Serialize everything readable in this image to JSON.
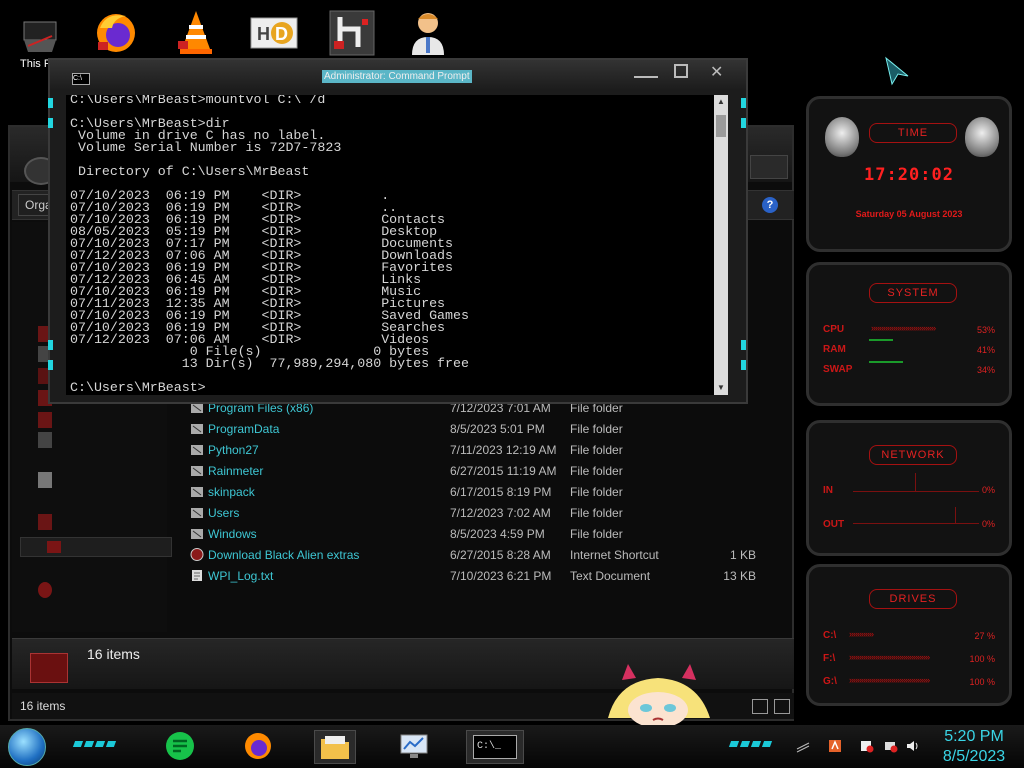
{
  "desktop": {
    "this_pc_label": "This PC"
  },
  "explorer": {
    "organize_label": "Orga",
    "help_label": "?",
    "files": [
      {
        "name": "Program Files (x86)",
        "date": "7/12/2023 7:01 AM",
        "type": "File folder",
        "size": ""
      },
      {
        "name": "ProgramData",
        "date": "8/5/2023 5:01 PM",
        "type": "File folder",
        "size": ""
      },
      {
        "name": "Python27",
        "date": "7/11/2023 12:19 AM",
        "type": "File folder",
        "size": ""
      },
      {
        "name": "Rainmeter",
        "date": "6/27/2015 11:19 AM",
        "type": "File folder",
        "size": ""
      },
      {
        "name": "skinpack",
        "date": "6/17/2015 8:19 PM",
        "type": "File folder",
        "size": ""
      },
      {
        "name": "Users",
        "date": "7/12/2023 7:02 AM",
        "type": "File folder",
        "size": ""
      },
      {
        "name": "Windows",
        "date": "8/5/2023 4:59 PM",
        "type": "File folder",
        "size": ""
      },
      {
        "name": "Download Black Alien extras",
        "date": "6/27/2015 8:28 AM",
        "type": "Internet Shortcut",
        "size": "1 KB"
      },
      {
        "name": "WPI_Log.txt",
        "date": "7/10/2023 6:21 PM",
        "type": "Text Document",
        "size": "13 KB"
      }
    ],
    "details_count": "16 items",
    "status_count": "16 items"
  },
  "cmd": {
    "title": "Administrator: Command Prompt",
    "icon_text": "C:\\",
    "console_text": "C:\\Users\\MrBeast>mountvol C:\\ /d\n\nC:\\Users\\MrBeast>dir\n Volume in drive C has no label.\n Volume Serial Number is 72D7-7823\n\n Directory of C:\\Users\\MrBeast\n\n07/10/2023  06:19 PM    <DIR>          .\n07/10/2023  06:19 PM    <DIR>          ..\n07/10/2023  06:19 PM    <DIR>          Contacts\n08/05/2023  05:19 PM    <DIR>          Desktop\n07/10/2023  07:17 PM    <DIR>          Documents\n07/12/2023  07:06 AM    <DIR>          Downloads\n07/10/2023  06:19 PM    <DIR>          Favorites\n07/12/2023  06:45 AM    <DIR>          Links\n07/10/2023  06:19 PM    <DIR>          Music\n07/11/2023  12:35 AM    <DIR>          Pictures\n07/10/2023  06:19 PM    <DIR>          Saved Games\n07/10/2023  06:19 PM    <DIR>          Searches\n07/12/2023  07:06 AM    <DIR>          Videos\n               0 File(s)              0 bytes\n              13 Dir(s)  77,989,294,080 bytes free\n\nC:\\Users\\MrBeast>"
  },
  "gadgets": {
    "time": {
      "heading": "TIME",
      "clock": "17:20:02",
      "date": "Saturday 05 August 2023"
    },
    "system": {
      "heading": "SYSTEM",
      "rows": [
        {
          "label": "CPU",
          "bar": "»»»»»»»»»»»»»»»»",
          "value": "53%"
        },
        {
          "label": "RAM",
          "bar": "",
          "value": "41%"
        },
        {
          "label": "SWAP",
          "bar": "",
          "value": "34%"
        }
      ]
    },
    "network": {
      "heading": "NETWORK",
      "rows": [
        {
          "label": "IN",
          "value": "0%"
        },
        {
          "label": "OUT",
          "value": "0%"
        }
      ]
    },
    "drives": {
      "heading": "DRIVES",
      "rows": [
        {
          "label": "C:\\",
          "bar": "»»»»»»",
          "value": "27 %"
        },
        {
          "label": "F:\\",
          "bar": "»»»»»»»»»»»»»»»»»»»»",
          "value": "100 %"
        },
        {
          "label": "G:\\",
          "bar": "»»»»»»»»»»»»»»»»»»»»",
          "value": "100 %"
        }
      ]
    }
  },
  "taskbar": {
    "time": "5:20 PM",
    "date": "8/5/2023",
    "cmd_button_label": "C:\\_"
  },
  "colors": {
    "accent_cyan": "#22d6e0",
    "alien_red": "#e01919",
    "link_cyan": "#3ec7d4"
  }
}
